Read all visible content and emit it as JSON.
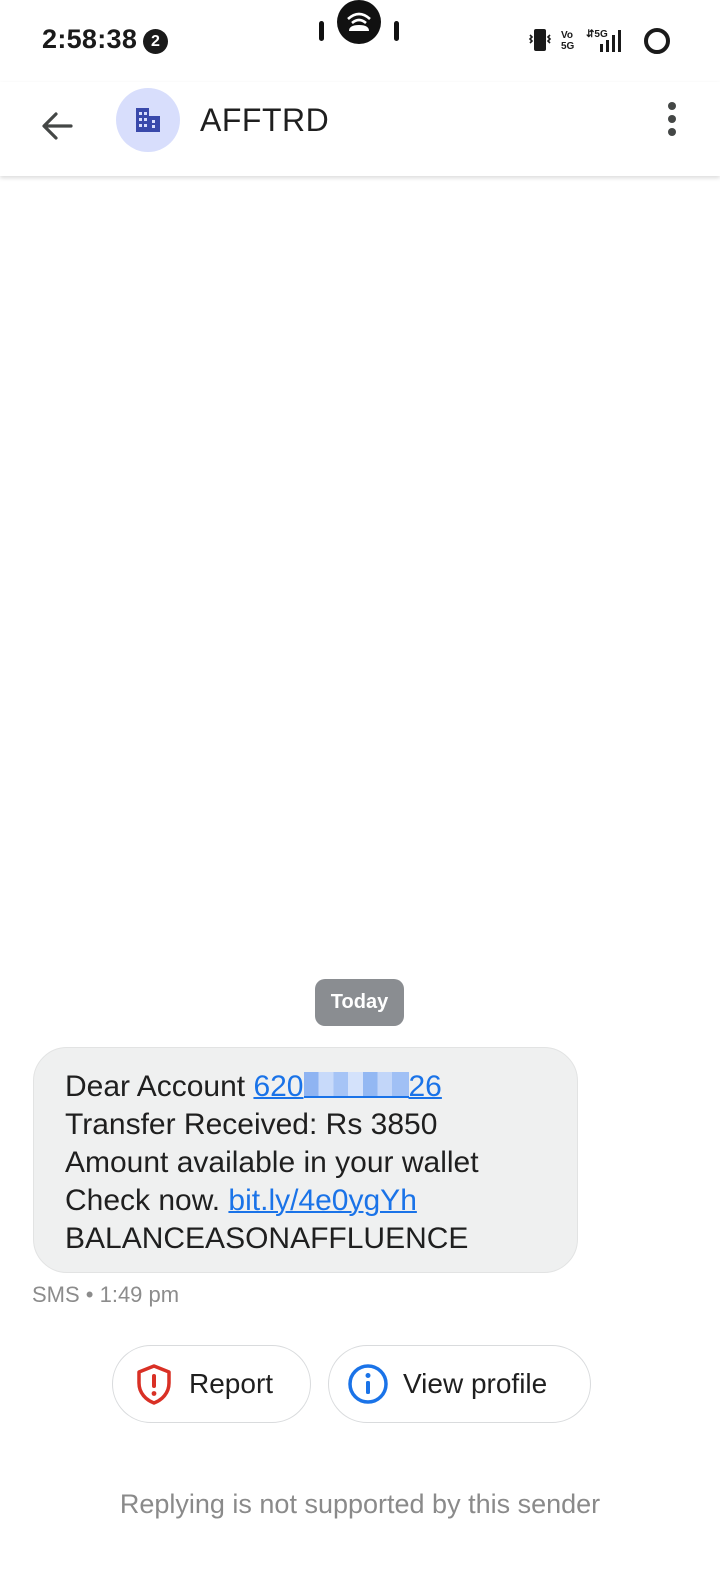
{
  "status_bar": {
    "time": "2:58:38",
    "notification_count": "2",
    "network_label": "5G",
    "volte_label": "Vo 5G"
  },
  "app_bar": {
    "sender_name": "AFFTRD",
    "avatar_icon": "business-building-icon",
    "back_icon": "arrow-back-icon",
    "menu_icon": "more-vert-icon"
  },
  "conversation": {
    "date_label": "Today",
    "message": {
      "line1_prefix": "Dear Account ",
      "account_start": "620",
      "account_end": "26",
      "line2": "Transfer Received: Rs 3850",
      "line3": "Amount available in your wallet",
      "line4_prefix": "Check now. ",
      "link": "bit.ly/4e0ygYh",
      "line5": "BALANCEASONAFFLUENCE"
    },
    "meta": "SMS • 1:49 pm"
  },
  "actions": {
    "report_label": "Report",
    "report_icon": "shield-alert-icon",
    "view_profile_label": "View profile",
    "view_profile_icon": "info-icon"
  },
  "footer": {
    "note": "Replying is not supported by this sender"
  },
  "colors": {
    "link": "#1a73e8",
    "bubble": "#eff0f0",
    "date_chip": "#8a8d91",
    "avatar_bg": "#d8defc",
    "report_red": "#d93025"
  }
}
